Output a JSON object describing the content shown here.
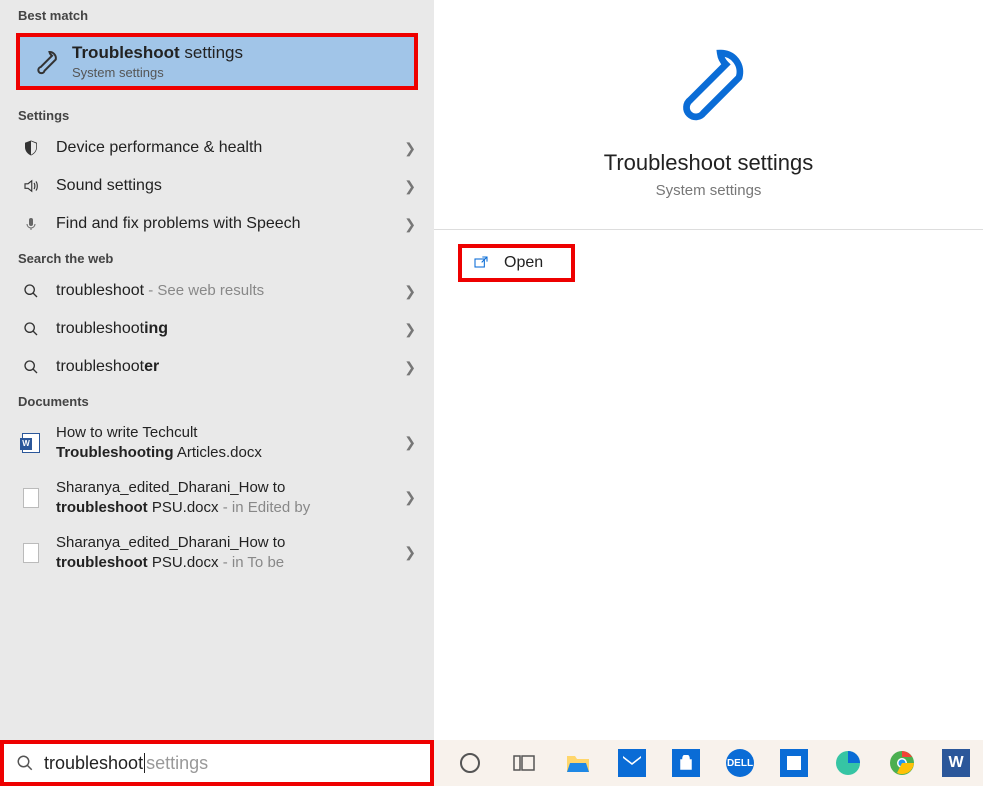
{
  "sections": {
    "best_match": "Best match",
    "settings": "Settings",
    "search_web": "Search the web",
    "documents": "Documents"
  },
  "best_match": {
    "title_prefix_bold": "Troubleshoot",
    "title_rest": " settings",
    "subtitle": "System settings"
  },
  "settings_items": [
    {
      "icon": "shield",
      "label": "Device performance & health"
    },
    {
      "icon": "sound",
      "label": "Sound settings"
    },
    {
      "icon": "mic",
      "label": "Find and fix problems with Speech"
    }
  ],
  "web_items": [
    {
      "pre": "troubleshoot",
      "bold": "",
      "suffix_muted": " - See web results"
    },
    {
      "pre": "troubleshoot",
      "bold": "ing",
      "suffix_muted": ""
    },
    {
      "pre": "troubleshoot",
      "bold": "er",
      "suffix_muted": ""
    }
  ],
  "doc_items": [
    {
      "icon": "word",
      "line1_pre": "How to write Techcult ",
      "line2_bold": "Troubleshooting",
      "line2_rest": " Articles.docx",
      "meta": ""
    },
    {
      "icon": "file",
      "line1_pre": "Sharanya_edited_Dharani_How to ",
      "line2_bold": "troubleshoot",
      "line2_rest": " PSU.docx",
      "meta": " - in Edited by"
    },
    {
      "icon": "file",
      "line1_pre": "Sharanya_edited_Dharani_How to ",
      "line2_bold": "troubleshoot",
      "line2_rest": " PSU.docx",
      "meta": " - in To be"
    }
  ],
  "search_input": {
    "typed": "troubleshoot",
    "hint": " settings"
  },
  "detail": {
    "title": "Troubleshoot settings",
    "subtitle": "System settings",
    "open_label": "Open"
  },
  "taskbar_icons": [
    "cortana",
    "taskview",
    "explorer",
    "mail",
    "store",
    "dell",
    "office",
    "edge",
    "chrome",
    "word"
  ]
}
